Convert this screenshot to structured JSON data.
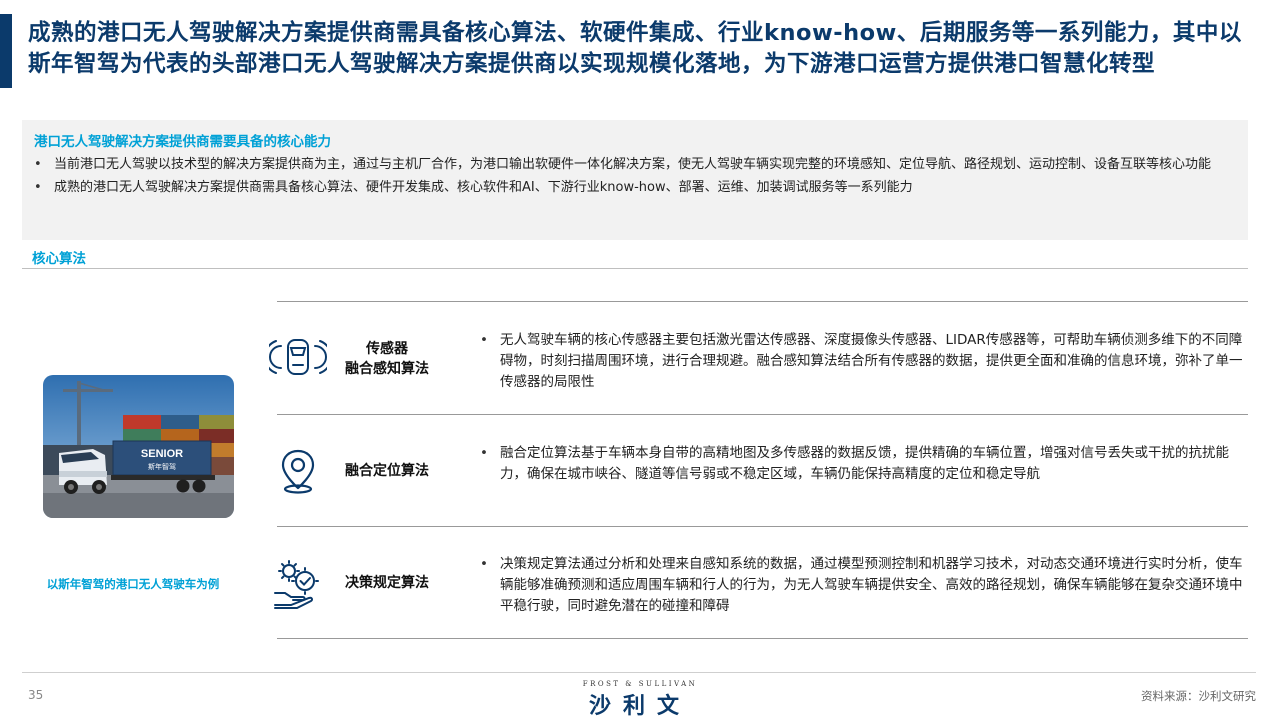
{
  "title": "成熟的港口无人驾驶解决方案提供商需具备核心算法、软硬件集成、行业know-how、后期服务等一系列能力，其中以斯年智驾为代表的头部港口无人驾驶解决方案提供商以实现规模化落地，为下游港口运营方提供港口智慧化转型",
  "panel": {
    "title": "港口无人驾驶解决方案提供商需要具备的核心能力",
    "bullets": [
      "当前港口无人驾驶以技术型的解决方案提供商为主，通过与主机厂合作，为港口输出软硬件一体化解决方案，使无人驾驶车辆实现完整的环境感知、定位导航、路径规划、运动控制、设备互联等核心功能",
      "成熟的港口无人驾驶解决方案提供商需具备核心算法、硬件开发集成、核心软件和AI、下游行业know-how、部署、运维、加装调试服务等一系列能力"
    ]
  },
  "section_title": "核心算法",
  "photo": {
    "truck_brand_en": "SENIOR",
    "truck_brand_cn": "斯年智驾"
  },
  "caption": "以斯年智驾的港口无人驾驶车为例",
  "rows": [
    {
      "icon": "car-sensor-icon",
      "label_line1": "传感器",
      "label_line2": "融合感知算法",
      "text": "无人驾驶车辆的核心传感器主要包括激光雷达传感器、深度摄像头传感器、LIDAR传感器等，可帮助车辆侦测多维下的不同障碍物，时刻扫描周围环境，进行合理规避。融合感知算法结合所有传感器的数据，提供更全面和准确的信息环境，弥补了单一传感器的局限性"
    },
    {
      "icon": "location-pin-icon",
      "label_line1": "融合定位算法",
      "text": "融合定位算法基于车辆本身自带的高精地图及多传感器的数据反馈，提供精确的车辆位置，增强对信号丢失或干扰的抗扰能力，确保在城市峡谷、隧道等信号弱或不稳定区域，车辆仍能保持高精度的定位和稳定导航"
    },
    {
      "icon": "decision-gears-icon",
      "label_line1": "决策规定算法",
      "text": "决策规定算法通过分析和处理来自感知系统的数据，通过模型预测控制和机器学习技术，对动态交通环境进行实时分析，使车辆能够准确预测和适应周围车辆和行人的行为，为无人驾驶车辆提供安全、高效的路径规划，确保车辆能够在复杂交通环境中平稳行驶，同时避免潜在的碰撞和障碍"
    }
  ],
  "footer": {
    "page_number": "35",
    "brand_en": "FROST & SULLIVAN",
    "brand_cn": "沙利文",
    "source": "资料来源：沙利文研究"
  }
}
